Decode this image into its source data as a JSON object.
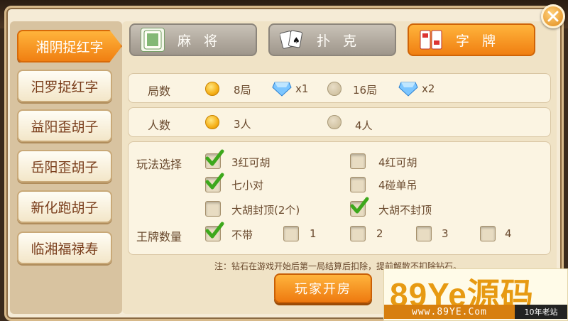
{
  "sidebar": {
    "items": [
      {
        "label": "湘阴捉红字",
        "active": true
      },
      {
        "label": "汨罗捉红字",
        "active": false
      },
      {
        "label": "益阳歪胡子",
        "active": false
      },
      {
        "label": "岳阳歪胡子",
        "active": false
      },
      {
        "label": "新化跑胡子",
        "active": false
      },
      {
        "label": "临湘福禄寿",
        "active": false
      }
    ]
  },
  "tabs": [
    {
      "label": "麻将",
      "icon": "mahjong-tile-icon",
      "active": false
    },
    {
      "label": "扑克",
      "icon": "playing-cards-icon",
      "active": false
    },
    {
      "label": "字牌",
      "icon": "zipai-cards-icon",
      "active": true
    }
  ],
  "rounds": {
    "label": "局数",
    "options": [
      {
        "text": "8局",
        "selected": true,
        "cost": "x1"
      },
      {
        "text": "16局",
        "selected": false,
        "cost": "x2"
      }
    ]
  },
  "players": {
    "label": "人数",
    "options": [
      {
        "text": "3人",
        "selected": true
      },
      {
        "text": "4人",
        "selected": false
      }
    ]
  },
  "rules": {
    "label": "玩法选择",
    "options": [
      {
        "text": "3红可胡",
        "checked": true
      },
      {
        "text": "4红可胡",
        "checked": false
      },
      {
        "text": "七小对",
        "checked": true
      },
      {
        "text": "4碰单吊",
        "checked": false
      },
      {
        "text": "大胡封顶(2个)",
        "checked": false
      },
      {
        "text": "大胡不封顶",
        "checked": true
      }
    ]
  },
  "king_cards": {
    "label": "王牌数量",
    "options": [
      {
        "text": "不带",
        "checked": true
      },
      {
        "text": "1",
        "checked": false
      },
      {
        "text": "2",
        "checked": false
      },
      {
        "text": "3",
        "checked": false
      },
      {
        "text": "4",
        "checked": false
      }
    ]
  },
  "note": "注：钻石在游戏开始后第一局结算后扣除，提前解散不扣除钻石。",
  "create_button": "玩家开房",
  "watermark": {
    "logo_text": "89Ye源码",
    "url": "www.89YE.Com",
    "tag": "10年老站"
  },
  "colors": {
    "accent": "#f59a22",
    "panel": "#fbf4e2",
    "text": "#6a4a2e"
  }
}
